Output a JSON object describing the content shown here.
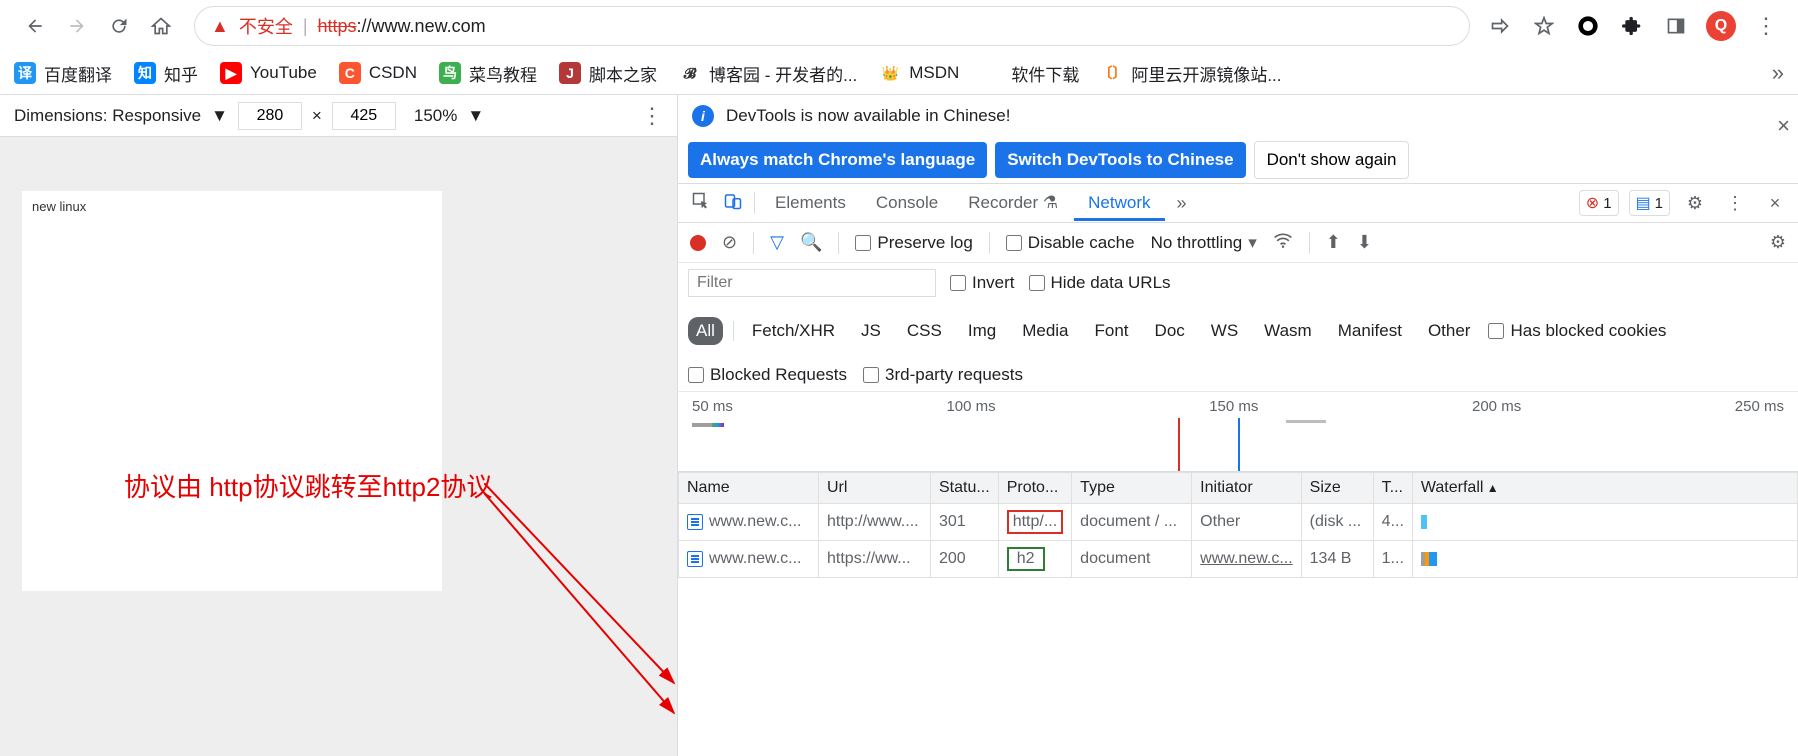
{
  "browser": {
    "not_secure": "不安全",
    "url_scheme": "https",
    "url_rest": "://www.new.com",
    "avatar_letter": "Q"
  },
  "bookmarks": [
    {
      "label": "百度翻译",
      "bg": "#2196f3",
      "ic": "译"
    },
    {
      "label": "知乎",
      "bg": "#0084ff",
      "ic": "知"
    },
    {
      "label": "YouTube",
      "bg": "#ff0000",
      "ic": "▶"
    },
    {
      "label": "CSDN",
      "bg": "#fc5531",
      "ic": "C"
    },
    {
      "label": "菜鸟教程",
      "bg": "#3caf4f",
      "ic": "鸟"
    },
    {
      "label": "脚本之家",
      "bg": "#b33939",
      "ic": "J"
    },
    {
      "label": "博客园 - 开发者的...",
      "bg": "transparent",
      "ic": "𝓑",
      "fg": "#333"
    },
    {
      "label": "MSDN",
      "bg": "transparent",
      "ic": "👑",
      "fg": "#0078d4"
    },
    {
      "label": "软件下载",
      "bg": "transparent",
      "ic": "■"
    },
    {
      "label": "阿里云开源镜像站...",
      "bg": "transparent",
      "ic": "〔〕",
      "fg": "#ff6a00"
    }
  ],
  "device": {
    "dimensions_label": "Dimensions: Responsive",
    "width": "280",
    "height": "425",
    "zoom": "150%",
    "page_text": "new linux"
  },
  "annotation": "协议由 http协议跳转至http2协议",
  "devtools": {
    "notice": "DevTools is now available in Chinese!",
    "btn_match": "Always match Chrome's language",
    "btn_switch": "Switch DevTools to Chinese",
    "btn_dont": "Don't show again",
    "tabs": {
      "elements": "Elements",
      "console": "Console",
      "recorder": "Recorder",
      "network": "Network"
    },
    "badges": {
      "errors": "1",
      "messages": "1"
    },
    "controls": {
      "preserve": "Preserve log",
      "disable_cache": "Disable cache",
      "throttling": "No throttling"
    },
    "filter": {
      "placeholder": "Filter",
      "invert": "Invert",
      "hide_data": "Hide data URLs",
      "types": [
        "All",
        "Fetch/XHR",
        "JS",
        "CSS",
        "Img",
        "Media",
        "Font",
        "Doc",
        "WS",
        "Wasm",
        "Manifest",
        "Other"
      ],
      "blocked_cookies": "Has blocked cookies",
      "blocked_req": "Blocked Requests",
      "third_party": "3rd-party requests"
    },
    "timeline": [
      "50 ms",
      "100 ms",
      "150 ms",
      "200 ms",
      "250 ms"
    ],
    "table": {
      "headers": {
        "name": "Name",
        "url": "Url",
        "status": "Statu...",
        "proto": "Proto...",
        "type": "Type",
        "initiator": "Initiator",
        "size": "Size",
        "time": "T...",
        "waterfall": "Waterfall"
      },
      "rows": [
        {
          "name": "www.new.c...",
          "url": "http://www....",
          "status": "301",
          "proto": "http/...",
          "proto_style": "red",
          "type": "document / ...",
          "initiator": "Other",
          "initiator_link": false,
          "size": "(disk ...",
          "time": "4..."
        },
        {
          "name": "www.new.c...",
          "url": "https://ww...",
          "status": "200",
          "proto": "h2",
          "proto_style": "green",
          "type": "document",
          "initiator": "www.new.c...",
          "initiator_link": true,
          "size": "134 B",
          "time": "1..."
        }
      ]
    }
  }
}
